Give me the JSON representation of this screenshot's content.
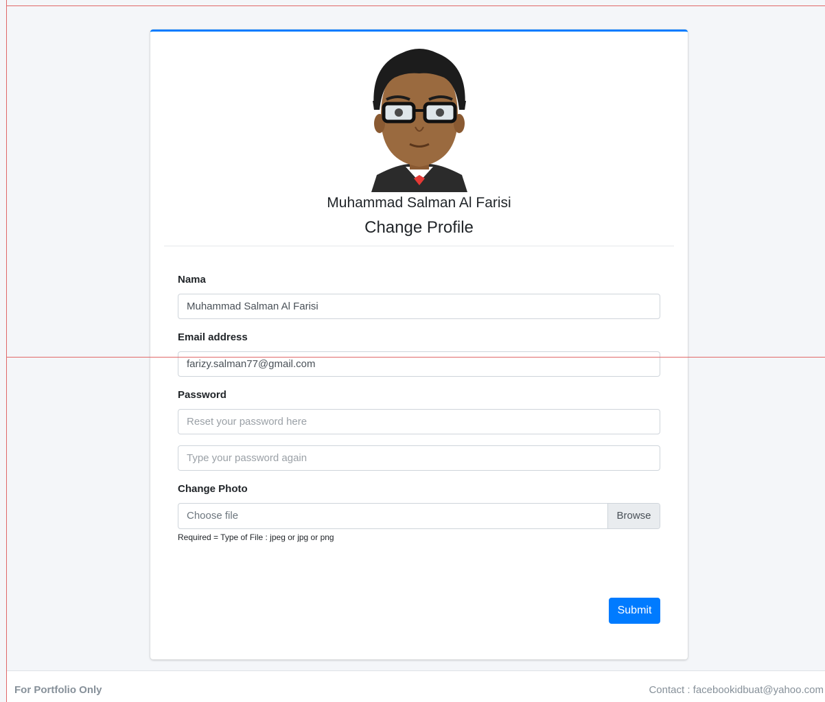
{
  "profile": {
    "name": "Muhammad Salman Al Farisi",
    "card_title": "Change Profile"
  },
  "form": {
    "name_label": "Nama",
    "name_value": "Muhammad Salman Al Farisi",
    "email_label": "Email address",
    "email_value": "farizy.salman77@gmail.com",
    "password_label": "Password",
    "password_placeholder": "Reset your password here",
    "password_confirm_placeholder": "Type your password again",
    "photo_label": "Change Photo",
    "file_placeholder": "Choose file",
    "browse_label": "Browse",
    "photo_help": "Required = Type of File : jpeg or jpg or png",
    "submit_label": "Submit"
  },
  "footer": {
    "left_text": "For Portfolio Only",
    "contact_text": "Contact : facebookidbuat@yahoo.com"
  },
  "colors": {
    "accent": "#007bff",
    "page_background": "#f4f6f9",
    "guide_line": "#e06666"
  },
  "icons": {
    "avatar": "cartoon-man-with-glasses-avatar"
  }
}
